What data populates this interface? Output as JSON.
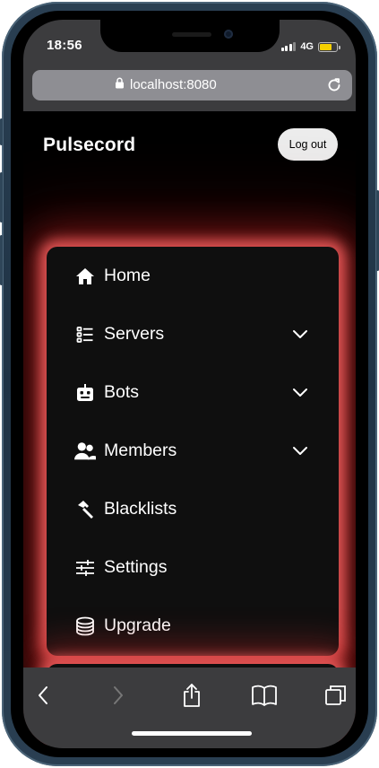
{
  "status_bar": {
    "time": "18:56",
    "network": "4G"
  },
  "browser": {
    "url": "localhost:8080"
  },
  "header": {
    "brand": "Pulsecord",
    "logout_label": "Log out"
  },
  "nav": {
    "items": [
      {
        "label": "Home",
        "icon": "home-icon",
        "expandable": false
      },
      {
        "label": "Servers",
        "icon": "server-list-icon",
        "expandable": true
      },
      {
        "label": "Bots",
        "icon": "robot-icon",
        "expandable": true
      },
      {
        "label": "Members",
        "icon": "users-icon",
        "expandable": true
      },
      {
        "label": "Blacklists",
        "icon": "hammer-icon",
        "expandable": false
      },
      {
        "label": "Settings",
        "icon": "sliders-icon",
        "expandable": false
      },
      {
        "label": "Upgrade",
        "icon": "coins-icon",
        "expandable": false
      }
    ]
  },
  "toolbar": {
    "buttons": [
      "back-icon",
      "forward-icon",
      "share-icon",
      "bookmarks-icon",
      "tabs-icon"
    ]
  },
  "colors": {
    "glow": "#e85c5c",
    "card": "#0f0f0f",
    "browser_chrome": "#3c3c3e",
    "url_field": "#8e8e93",
    "battery": "#f5d000"
  }
}
